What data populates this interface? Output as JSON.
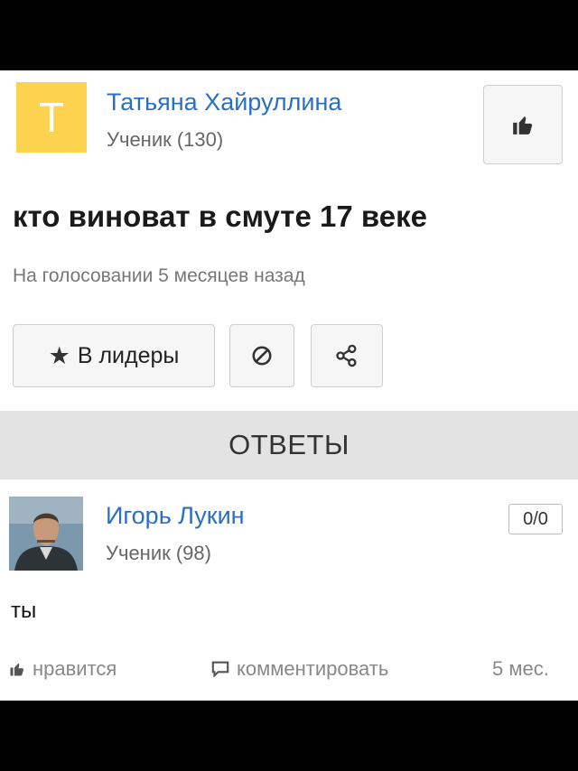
{
  "question": {
    "author": {
      "initial": "T",
      "name": "Татьяна Хайруллина",
      "rank": "Ученик (130)"
    },
    "title": "кто виноват в смуте 17 веке",
    "meta": "На голосовании 5 месяцев назад",
    "actions": {
      "leaders_label": "В лидеры",
      "star": "★"
    }
  },
  "answers_header": "ОТВЕТЫ",
  "answer": {
    "author": {
      "name": "Игорь Лукин",
      "rank": "Ученик (98)"
    },
    "score": "0/0",
    "text": "ты",
    "footer": {
      "like_label": "нравится",
      "comment_label": "комментировать",
      "time": "5 мес."
    }
  },
  "colors": {
    "accent_blue": "#2b6fc2",
    "avatar_yellow": "#fdd24f",
    "answers_bar_bg": "#e3e3e3"
  },
  "icons": [
    "thumbs-up-icon",
    "star-icon",
    "block-icon",
    "share-icon",
    "comment-icon"
  ]
}
